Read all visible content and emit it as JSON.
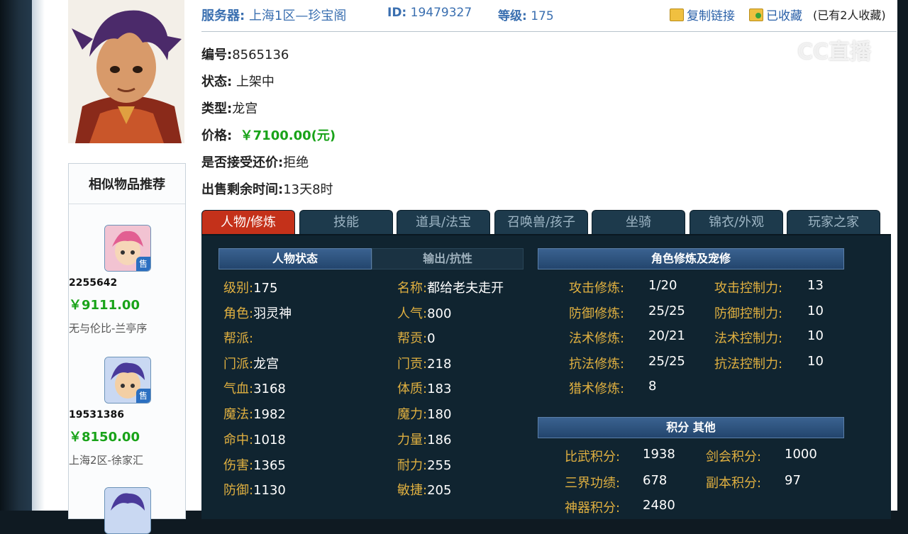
{
  "header": {
    "server_label": "服务器:",
    "server_value": "上海1区—珍宝阁",
    "id_label": "ID:",
    "id_value": "19479327",
    "level_label": "等级:",
    "level_value": "175",
    "copy_link": "复制链接",
    "favorited": "已收藏",
    "fav_count": "(已有2人收藏)"
  },
  "info": {
    "number_label": "编号:",
    "number_value": "8565136",
    "status_label": "状态:",
    "status_value": "上架中",
    "type_label": "类型:",
    "type_value": "龙宫",
    "price_label": "价格:",
    "price_value": "￥7100.00(元)",
    "bargain_label": "是否接受还价:",
    "bargain_value": "拒绝",
    "remaining_label": "出售剩余时间:",
    "remaining_value": "13天8时"
  },
  "similar": {
    "title": "相似物品推荐",
    "badge": "售",
    "items": [
      {
        "id": "2255642",
        "price": "￥9111.00",
        "server": "无与伦比-兰亭序"
      },
      {
        "id": "19531386",
        "price": "￥8150.00",
        "server": "上海2区-徐家汇"
      }
    ]
  },
  "tabs": [
    "人物/修炼",
    "技能",
    "道具/法宝",
    "召唤兽/孩子",
    "坐骑",
    "锦衣/外观",
    "玩家之家"
  ],
  "panel": {
    "status_head": "人物状态",
    "output_head": "输出/抗性",
    "cult_head": "角色修炼及宠修",
    "score_head": "积分 其他",
    "left_col": [
      {
        "k": "级别:",
        "v": "175"
      },
      {
        "k": "角色:",
        "v": "羽灵神"
      },
      {
        "k": "帮派:",
        "v": ""
      },
      {
        "k": "门派:",
        "v": "龙宫"
      },
      {
        "k": "气血:",
        "v": "3168"
      },
      {
        "k": "魔法:",
        "v": "1982"
      },
      {
        "k": "命中:",
        "v": "1018"
      },
      {
        "k": "伤害:",
        "v": "1365"
      },
      {
        "k": "防御:",
        "v": "1130"
      }
    ],
    "mid_col": [
      {
        "k": "名称:",
        "v": "都给老夫走开"
      },
      {
        "k": "人气:",
        "v": "800"
      },
      {
        "k": "帮贡:",
        "v": "0"
      },
      {
        "k": "门贡:",
        "v": "218"
      },
      {
        "k": "体质:",
        "v": "183"
      },
      {
        "k": "魔力:",
        "v": "180"
      },
      {
        "k": "力量:",
        "v": "186"
      },
      {
        "k": "耐力:",
        "v": "255"
      },
      {
        "k": "敏捷:",
        "v": "205"
      }
    ],
    "cult": [
      {
        "k": "攻击修炼:",
        "v": "1/20",
        "k2": "攻击控制力:",
        "v2": "13"
      },
      {
        "k": "防御修炼:",
        "v": "25/25",
        "k2": "防御控制力:",
        "v2": "10"
      },
      {
        "k": "法术修炼:",
        "v": "20/21",
        "k2": "法术控制力:",
        "v2": "10"
      },
      {
        "k": "抗法修炼:",
        "v": "25/25",
        "k2": "抗法控制力:",
        "v2": "10"
      },
      {
        "k": "猎术修炼:",
        "v": "8",
        "k2": "",
        "v2": ""
      }
    ],
    "score": [
      {
        "k": "比武积分:",
        "v": "1938",
        "k2": "剑会积分:",
        "v2": "1000"
      },
      {
        "k": "三界功绩:",
        "v": "678",
        "k2": "副本积分:",
        "v2": "97"
      },
      {
        "k": "神器积分:",
        "v": "2480",
        "k2": "",
        "v2": ""
      }
    ]
  },
  "watermark": {
    "text": "CC直播"
  }
}
